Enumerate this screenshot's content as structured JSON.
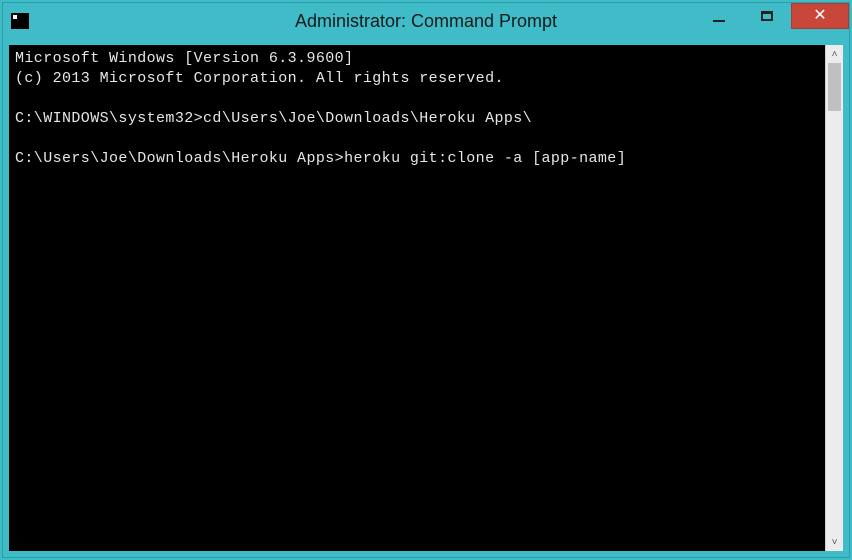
{
  "titlebar": {
    "title": "Administrator: Command Prompt"
  },
  "terminal": {
    "line1": "Microsoft Windows [Version 6.3.9600]",
    "line2": "(c) 2013 Microsoft Corporation. All rights reserved.",
    "blank1": "",
    "line3_prompt": "C:\\WINDOWS\\system32>",
    "line3_cmd": "cd\\Users\\Joe\\Downloads\\Heroku Apps\\",
    "blank2": "",
    "line4_prompt": "C:\\Users\\Joe\\Downloads\\Heroku Apps>",
    "line4_cmd": "heroku git:clone -a [app-name]"
  }
}
